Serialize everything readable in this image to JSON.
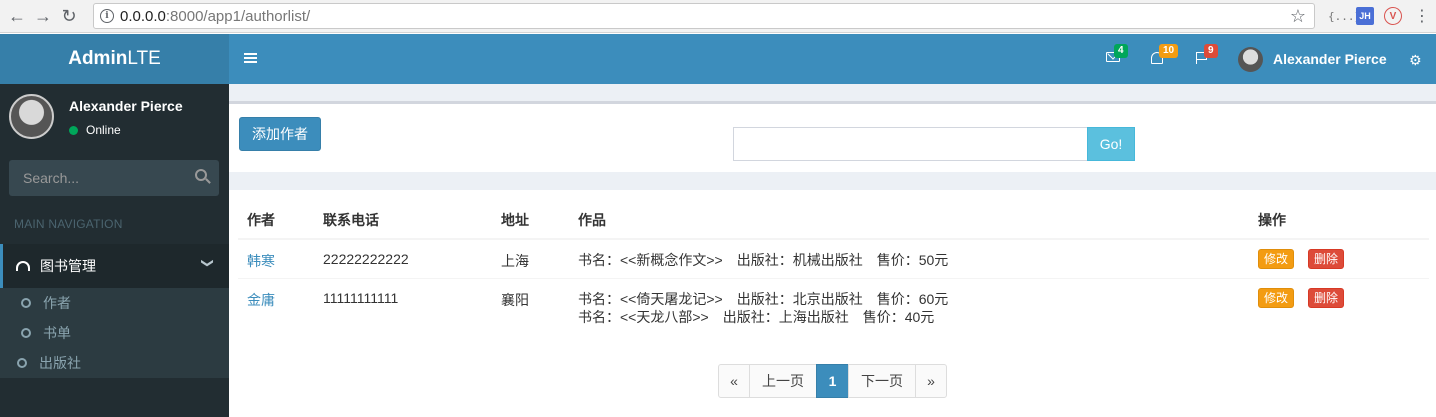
{
  "browser": {
    "url_host": "0.0.0.0",
    "url_rest": ":8000/app1/authorlist/",
    "ext_braces": "{...}",
    "ext_jh": "JH",
    "ext_v": "V"
  },
  "brand": {
    "bold": "Admin",
    "light": "LTE"
  },
  "user": {
    "name": "Alexander Pierce",
    "status": "Online"
  },
  "sidebar": {
    "search_placeholder": "Search...",
    "nav_header": "MAIN NAVIGATION",
    "menu_label": "图书管理",
    "sub_items": [
      {
        "label": "作者"
      },
      {
        "label": "书单"
      },
      {
        "label": "出版社"
      }
    ]
  },
  "header": {
    "mail_count": "4",
    "notif_count": "10",
    "task_count": "9",
    "user_name": "Alexander Pierce"
  },
  "toolbar": {
    "add_label": "添加作者",
    "search_value": "",
    "go_label": "Go!"
  },
  "table": {
    "columns": [
      "作者",
      "联系电话",
      "地址",
      "作品",
      "操作"
    ],
    "rows": [
      {
        "author": "韩寒",
        "phone": "22222222222",
        "address": "上海",
        "works": [
          {
            "book": "书名：<<新概念作文>>",
            "publisher": "出版社：机械出版社",
            "price": "售价：50元"
          }
        ],
        "edit": "修改",
        "delete": "删除"
      },
      {
        "author": "金庸",
        "phone": "11111111111",
        "address": "襄阳",
        "works": [
          {
            "book": "书名：<<倚天屠龙记>>",
            "publisher": "出版社：北京出版社",
            "price": "售价：60元"
          },
          {
            "book": "书名：<<天龙八部>>",
            "publisher": "出版社：上海出版社",
            "price": "售价：40元"
          }
        ],
        "edit": "修改",
        "delete": "删除"
      }
    ]
  },
  "pagination": {
    "first": "«",
    "prev": "上一页",
    "current": "1",
    "next": "下一页",
    "last": "»"
  },
  "colors": {
    "header": "#3c8dbc",
    "sidebar": "#222d32",
    "edit": "#f39c12",
    "delete": "#dd4b39",
    "go": "#5bc0de"
  }
}
